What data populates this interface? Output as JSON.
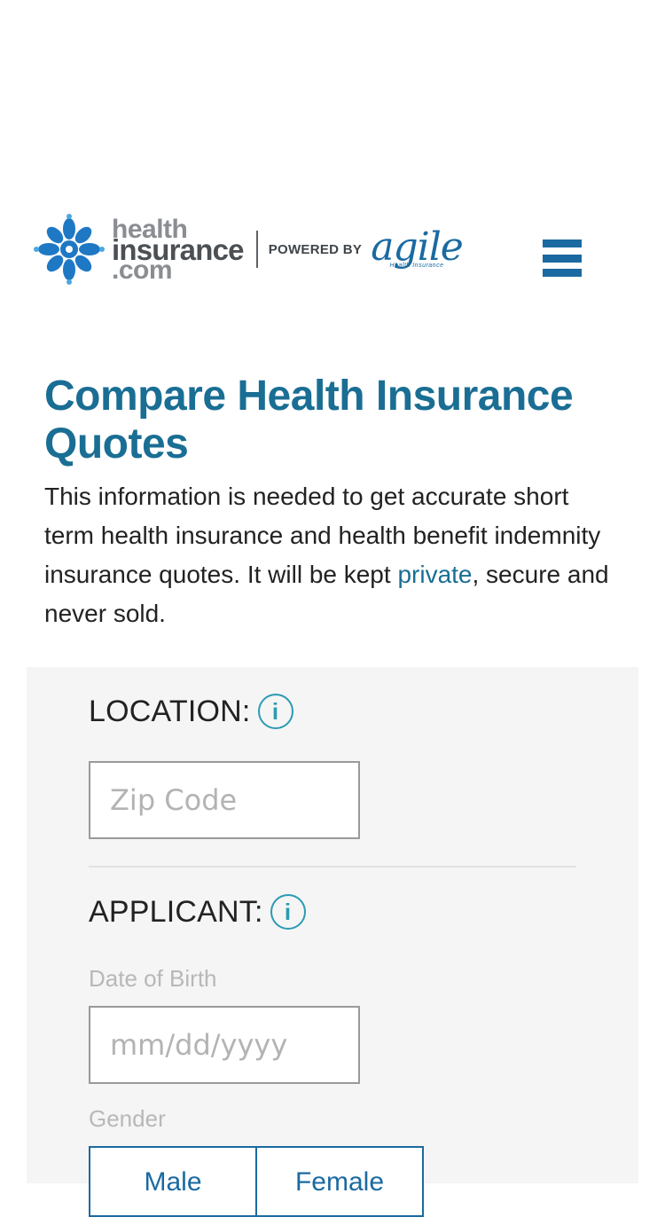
{
  "header": {
    "brand_line1": "health",
    "brand_line2": "insurance",
    "brand_line3": ".com",
    "powered_by": "POWERED BY",
    "agile": "agile",
    "agile_sub": "Health      Insurance",
    "menu_icon": "hamburger-icon",
    "accent": "#1a6aa1"
  },
  "intro": {
    "title": "Compare Health Insurance Quotes",
    "text_before": "This information is needed to get accurate short term health insurance and health benefit indemnity insurance quotes. It will be kept ",
    "link": "private",
    "text_after": ", secure and never sold."
  },
  "form": {
    "location_label": "LOCATION:",
    "info_glyph": "i",
    "zip_placeholder": "Zip Code",
    "applicant_label": "APPLICANT:",
    "dob_label": "Date of Birth",
    "dob_placeholder": "mm/dd/yyyy",
    "gender_label": "Gender",
    "gender_options": [
      "Male",
      "Female"
    ]
  }
}
